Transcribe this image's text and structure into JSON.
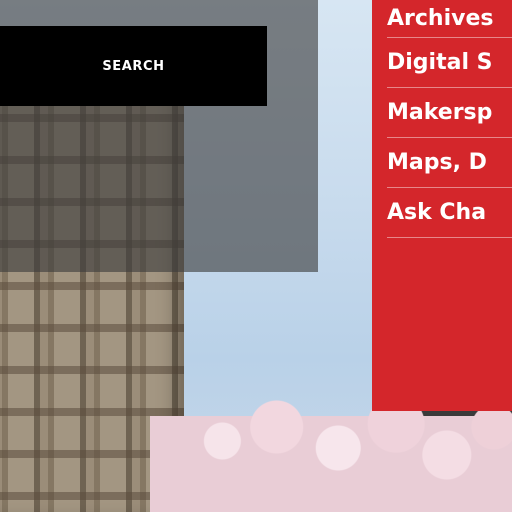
{
  "search": {
    "button_label": "SEARCH"
  },
  "quick_links": {
    "items": [
      {
        "label": "Archives"
      },
      {
        "label": "Digital S"
      },
      {
        "label": "Makersp"
      },
      {
        "label": "Maps, D"
      },
      {
        "label": "Ask Cha"
      }
    ]
  },
  "colors": {
    "panel_red": "#d4262b",
    "search_button_bg": "#000000",
    "search_overlay": "rgba(60,60,60,0.62)",
    "text_white": "#ffffff"
  }
}
